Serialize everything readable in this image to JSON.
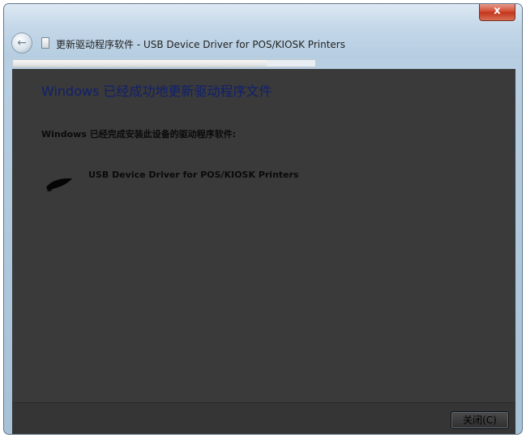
{
  "window": {
    "title": "更新驱动程序软件 - USB Device Driver for POS/KIOSK Printers",
    "close_glyph": "x"
  },
  "content": {
    "heading": "Windows 已经成功地更新驱动程序文件",
    "message": "Windows 已经完成安装此设备的驱动程序软件:",
    "device_name": "USB Device Driver for POS/KIOSK Printers"
  },
  "footer": {
    "close_label": "关闭(C)"
  },
  "colors": {
    "content_bg": "#3a3a3a",
    "heading": "#10206e",
    "titlebar": "#c3d7e8"
  },
  "icons": {
    "back": "back-arrow-icon",
    "app": "app-icon",
    "device": "printer-device-icon"
  }
}
